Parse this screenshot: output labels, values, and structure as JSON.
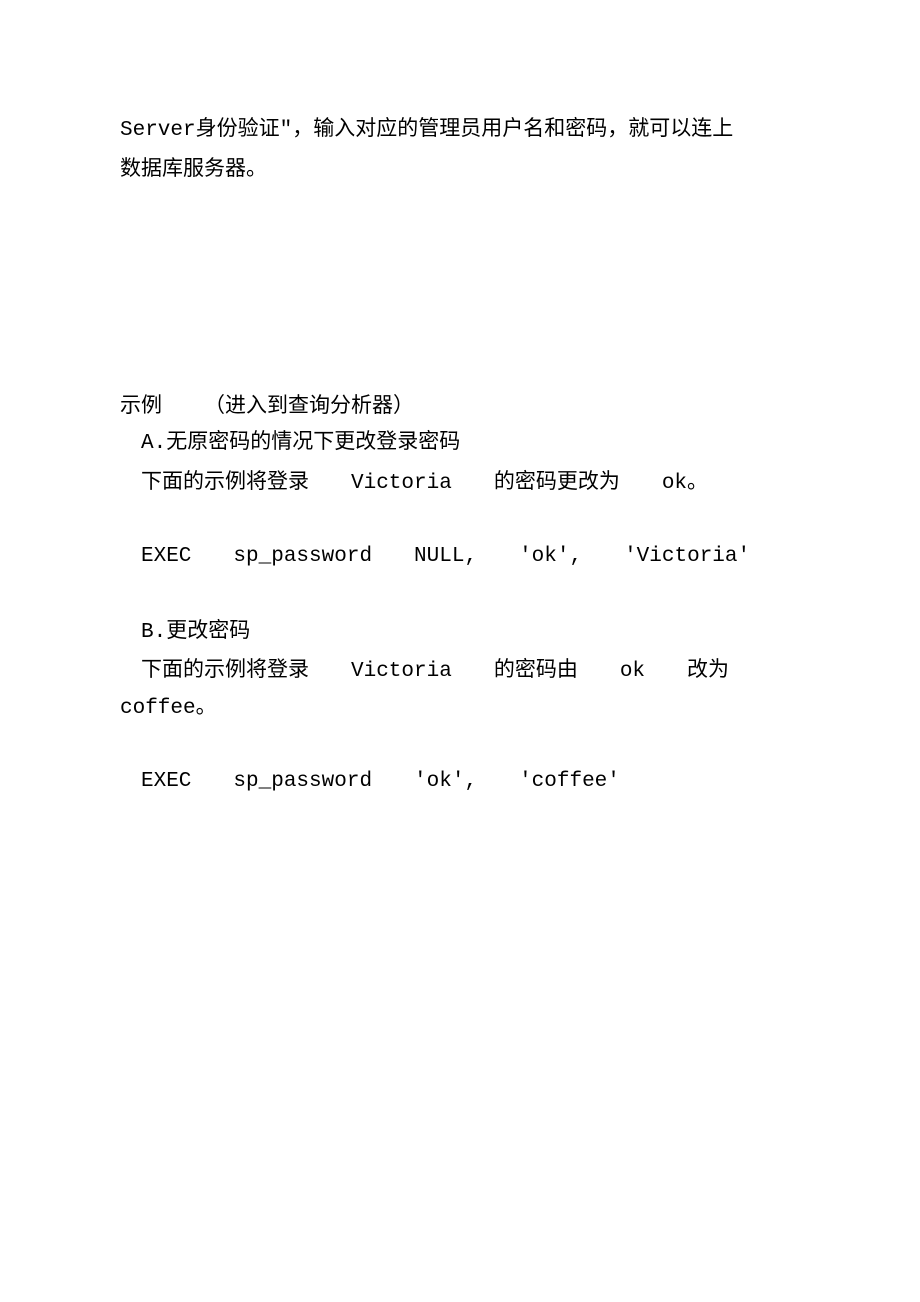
{
  "intro": {
    "line1_part1": "Server身份验证\"，输入对应的管理员用户名和密码，就可以连上",
    "line2": "数据库服务器。"
  },
  "example": {
    "heading_prefix": "示例",
    "heading_suffix": "（进入到查询分析器）",
    "a_title": "A.无原密码的情况下更改登录密码",
    "a_desc_p1": "下面的示例将登录",
    "a_desc_p2": "Victoria",
    "a_desc_p3": "的密码更改为",
    "a_desc_p4": "ok。",
    "a_code_exec": "EXEC",
    "a_code_sp": "sp_password",
    "a_code_arg1": "NULL,",
    "a_code_arg2": "'ok',",
    "a_code_arg3": "'Victoria'",
    "b_title": "B.更改密码",
    "b_desc_p1": "下面的示例将登录",
    "b_desc_p2": "Victoria",
    "b_desc_p3": "的密码由",
    "b_desc_p4": "ok",
    "b_desc_p5": "改为",
    "b_desc_line2": "coffee。",
    "b_code_exec": "EXEC",
    "b_code_sp": "sp_password",
    "b_code_arg1": "'ok',",
    "b_code_arg2": "'coffee'"
  }
}
